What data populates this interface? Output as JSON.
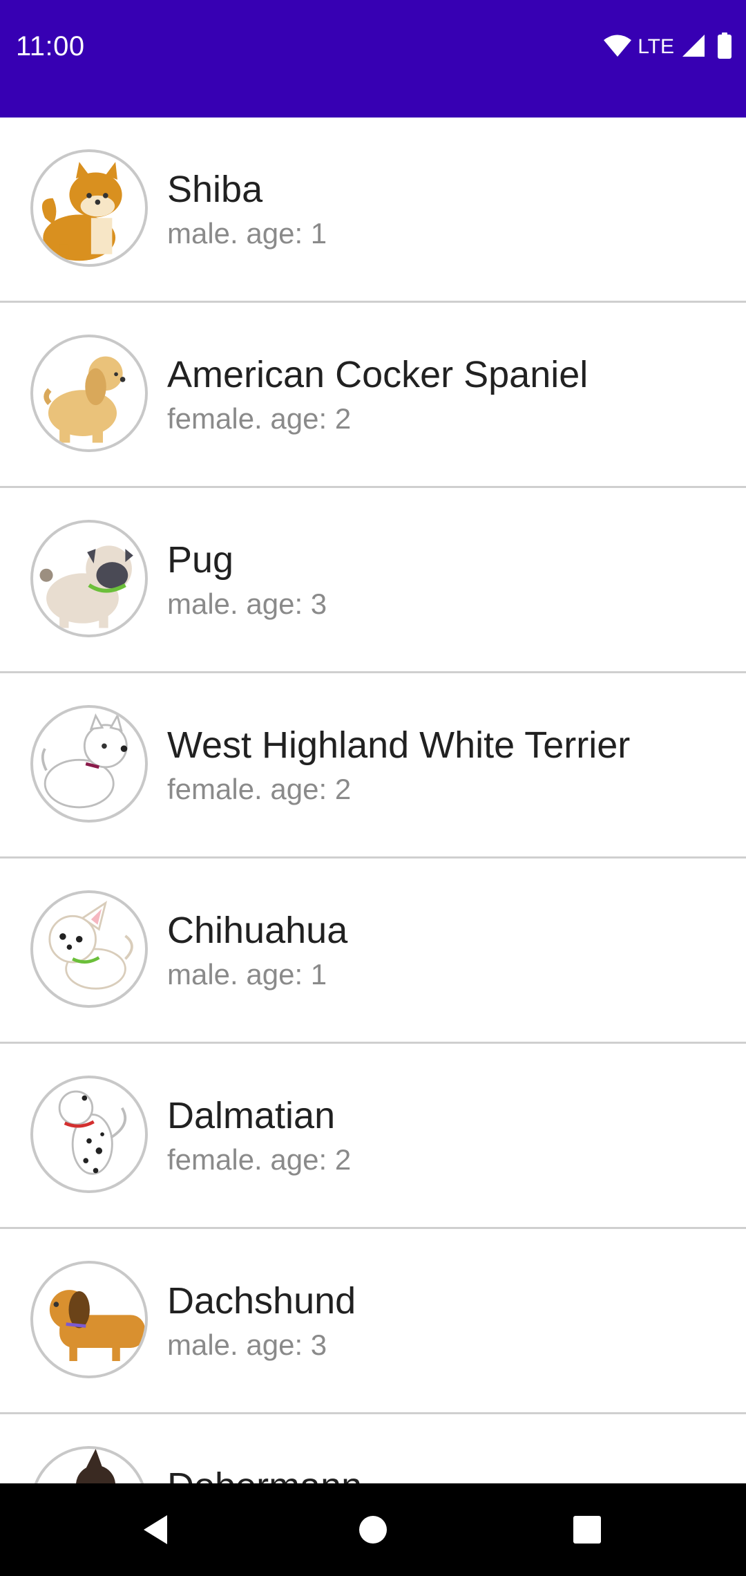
{
  "status_bar": {
    "time": "11:00",
    "network": "LTE",
    "icons": [
      "wifi-icon",
      "cell-signal-icon",
      "battery-icon"
    ]
  },
  "dogs": [
    {
      "name": "Shiba",
      "info": "male. age: 1",
      "icon": "shiba-avatar"
    },
    {
      "name": "American Cocker Spaniel",
      "info": "female. age: 2",
      "icon": "cocker-spaniel-avatar"
    },
    {
      "name": "Pug",
      "info": "male. age: 3",
      "icon": "pug-avatar"
    },
    {
      "name": "West Highland White Terrier",
      "info": "female. age: 2",
      "icon": "westie-avatar"
    },
    {
      "name": "Chihuahua",
      "info": "male. age: 1",
      "icon": "chihuahua-avatar"
    },
    {
      "name": "Dalmatian",
      "info": "female. age: 2",
      "icon": "dalmatian-avatar"
    },
    {
      "name": "Dachshund",
      "info": "male. age: 3",
      "icon": "dachshund-avatar"
    },
    {
      "name": "Dobermann",
      "info": "",
      "icon": "dobermann-avatar"
    }
  ],
  "nav_bar": {
    "icons": [
      "back-icon",
      "home-icon",
      "recents-icon"
    ]
  },
  "colors": {
    "status_bar": "#3700b3",
    "divider": "#cfcfcf",
    "title_text": "#212121",
    "subtitle_text": "#8a8a8a"
  }
}
